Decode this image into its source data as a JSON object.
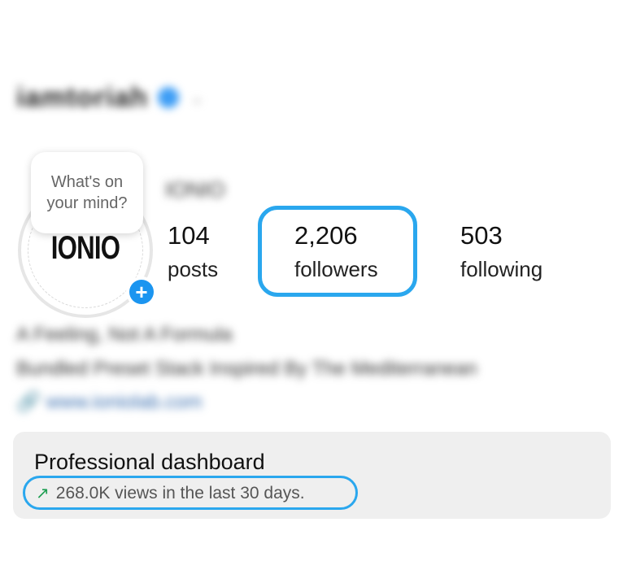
{
  "profile": {
    "username": "iamtoriah",
    "display_name": "IONIO",
    "avatar_logo": "IONIO",
    "note_placeholder": "What's on your mind?"
  },
  "stats": {
    "posts": {
      "value": "104",
      "label": "posts"
    },
    "followers": {
      "value": "2,206",
      "label": "followers"
    },
    "following": {
      "value": "503",
      "label": "following"
    }
  },
  "bio": {
    "line1": "A Feeling, Not A Formula",
    "line2": "Bundled Preset Stack Inspired By The Mediterranean",
    "link": "www.ioniolab.com"
  },
  "dashboard": {
    "title": "Professional dashboard",
    "subtitle": "268.0K views in the last 30 days."
  },
  "icons": {
    "verified": "verified-badge-icon",
    "add_story": "plus-icon",
    "trend": "trend-up-arrow-icon",
    "link": "link-icon"
  },
  "colors": {
    "highlight": "#2aa7ee",
    "add_button": "#1b95f0",
    "trend_arrow": "#1e9e52",
    "card_background": "#efefef"
  }
}
